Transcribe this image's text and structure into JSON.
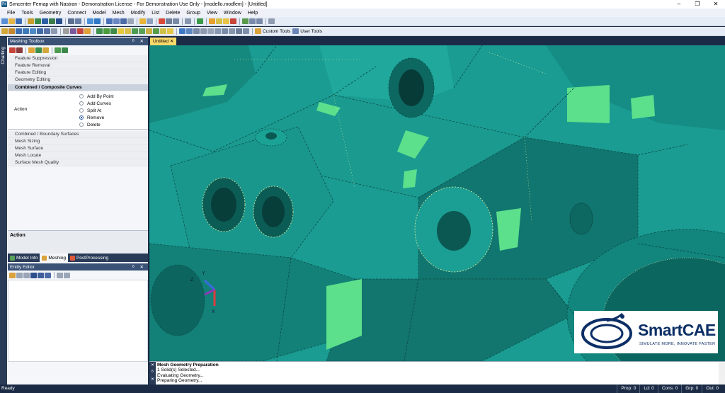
{
  "window": {
    "title": "Simcenter Femap with Nastran - Demonstration License - For Demonstration Use Only - [modello.modfem] - [Untitled]",
    "app_icon": "femap-app-icon",
    "controls": [
      "–",
      "❐",
      "✕"
    ]
  },
  "menu": [
    "File",
    "Tools",
    "Geometry",
    "Connect",
    "Model",
    "Mesh",
    "Modify",
    "List",
    "Delete",
    "Group",
    "View",
    "Window",
    "Help"
  ],
  "toolbar2_text": {
    "custom_tools": "Custom Tools",
    "user_tools": "User Tools"
  },
  "side_tab": "Charting",
  "meshing_toolbox": {
    "title": "Meshing Toolbox",
    "header_controls": "ᴮ ✕",
    "sections": [
      "Feature Suppression",
      "Feature Removal",
      "Feature Editing",
      "Geometry Editing"
    ],
    "active_section": "Combined / Composite Curves",
    "action_label": "Action",
    "action_options": [
      "Add By Point",
      "Add Curves",
      "Split At",
      "Remove",
      "Delete"
    ],
    "selected_option": "Remove",
    "sections_after": [
      "Combined / Boundary Surfaces",
      "Mesh Sizing",
      "Mesh Surface",
      "Mesh Locate",
      "Surface Mesh Quality"
    ],
    "help_title": "Action"
  },
  "bottom_tabs": [
    "Model Info",
    "Meshing",
    "PostProcessing"
  ],
  "active_bottom_tab": "Meshing",
  "entity_editor": {
    "title": "Entity Editor",
    "header_controls": "ᴮ ✕"
  },
  "document_tab": {
    "label": "Untitled",
    "close": "✕"
  },
  "triad": {
    "y": "Y",
    "z": "Z",
    "x": "X"
  },
  "logo": {
    "word": "SmartCAE",
    "tagline": "SIMULATE MORE, INNOVATE FASTER"
  },
  "messages": [
    "Mesh Geometry Preparation",
    "1 Solid(s) Selected...",
    "Evaluating Geometry...",
    "Preparing Geometry..."
  ],
  "message_side": [
    "✕",
    "ᴮ",
    "✕"
  ],
  "status": {
    "ready": "Ready",
    "counts": [
      "Prop: 0",
      "Ld: 0",
      "Cons: 0",
      "Grp: 0",
      "Out: 0"
    ]
  },
  "colors": {
    "model_base": "#1a9c92",
    "model_light": "#24b2a4",
    "model_dark": "#0b6e68",
    "highlight": "#5ce08c",
    "background": "#1b2b46",
    "panel_header": "#3b5277"
  }
}
